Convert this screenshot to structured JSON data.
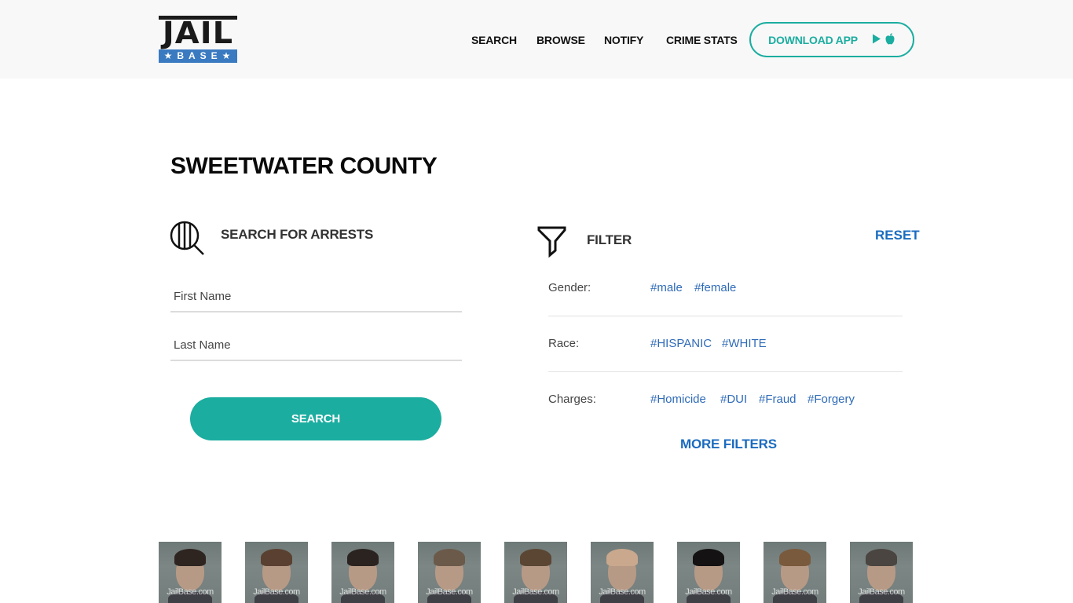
{
  "header": {
    "logo": {
      "top": "JAIL",
      "bottom": "★BASE★"
    },
    "nav": [
      {
        "label": "SEARCH"
      },
      {
        "label": "BROWSE"
      },
      {
        "label": "NOTIFY"
      },
      {
        "label": "CRIME STATS"
      }
    ],
    "download_app_label": "DOWNLOAD APP",
    "download_icons": [
      "google-play-icon",
      "apple-icon"
    ]
  },
  "page": {
    "title": "SWEETWATER COUNTY"
  },
  "search": {
    "heading": "SEARCH FOR ARRESTS",
    "first_name_placeholder": "First Name",
    "first_name_value": "",
    "last_name_placeholder": "Last Name",
    "last_name_value": "",
    "button_label": "SEARCH"
  },
  "filter": {
    "heading": "FILTER",
    "reset_label": "RESET",
    "rows": [
      {
        "label": "Gender:",
        "tags": [
          "#male",
          "#female"
        ]
      },
      {
        "label": "Race:",
        "tags": [
          "#HISPANIC",
          "#WHITE"
        ]
      },
      {
        "label": "Charges:",
        "tags": [
          "#Homicide",
          "#DUI",
          "#Fraud",
          "#Forgery"
        ]
      }
    ],
    "more_filters_label": "MORE FILTERS"
  },
  "mugshots": {
    "watermark": "JailBase.com",
    "count": 9
  },
  "colors": {
    "accent_teal": "#1bada0",
    "link_blue": "#1a6bbf",
    "tag_blue": "#2f6bb8",
    "logo_blue": "#3a7ac0",
    "header_bg": "#f8f8f8"
  }
}
